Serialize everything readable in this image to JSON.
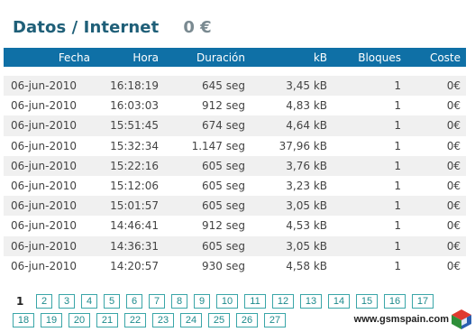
{
  "header": {
    "title": "Datos / Internet",
    "amount": "0 €"
  },
  "table": {
    "columns": [
      "Fecha",
      "Hora",
      "Duración",
      "kB",
      "Bloques",
      "Coste"
    ],
    "rows": [
      [
        "06-jun-2010",
        "16:18:19",
        "645 seg",
        "3,45 kB",
        "1",
        "0€"
      ],
      [
        "06-jun-2010",
        "16:03:03",
        "912 seg",
        "4,83 kB",
        "1",
        "0€"
      ],
      [
        "06-jun-2010",
        "15:51:45",
        "674 seg",
        "4,64 kB",
        "1",
        "0€"
      ],
      [
        "06-jun-2010",
        "15:32:34",
        "1.147 seg",
        "37,96 kB",
        "1",
        "0€"
      ],
      [
        "06-jun-2010",
        "15:22:16",
        "605 seg",
        "3,76 kB",
        "1",
        "0€"
      ],
      [
        "06-jun-2010",
        "15:12:06",
        "605 seg",
        "3,23 kB",
        "1",
        "0€"
      ],
      [
        "06-jun-2010",
        "15:01:57",
        "605 seg",
        "3,05 kB",
        "1",
        "0€"
      ],
      [
        "06-jun-2010",
        "14:46:41",
        "912 seg",
        "4,53 kB",
        "1",
        "0€"
      ],
      [
        "06-jun-2010",
        "14:36:31",
        "605 seg",
        "3,05 kB",
        "1",
        "0€"
      ],
      [
        "06-jun-2010",
        "14:20:57",
        "930 seg",
        "4,58 kB",
        "1",
        "0€"
      ]
    ]
  },
  "pagination": {
    "current": "1",
    "pages": [
      "2",
      "3",
      "4",
      "5",
      "6",
      "7",
      "8",
      "9",
      "10",
      "11",
      "12",
      "13",
      "14",
      "15",
      "16",
      "17",
      "18",
      "19",
      "20",
      "21",
      "22",
      "23",
      "24",
      "25",
      "26",
      "27"
    ]
  },
  "watermark": {
    "text": "www.gsmspain.com",
    "icon": "gsmspain-logo-icon"
  },
  "colors": {
    "header_bg": "#0f70a6",
    "title": "#1f5f78",
    "page_border": "#3aa6a8",
    "stripe": "#f0f0f0"
  }
}
